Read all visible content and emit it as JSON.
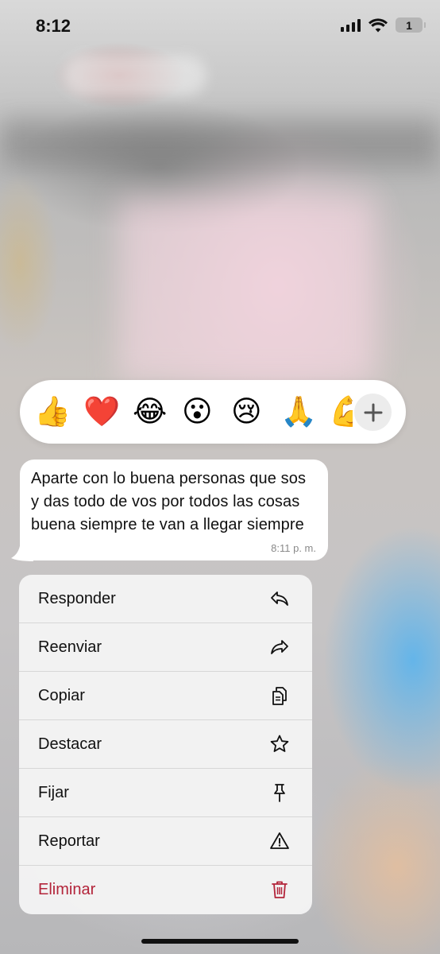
{
  "status_bar": {
    "time": "8:12",
    "battery_level": "1",
    "signal_icon": "cellular-signal-icon",
    "wifi_icon": "wifi-icon"
  },
  "reactions": {
    "emojis": [
      "👍",
      "❤️",
      "😂",
      "😮",
      "😢",
      "🙏",
      "💪"
    ],
    "more_icon": "plus-icon"
  },
  "message": {
    "text": "Aparte con lo buena personas que sos y das todo de vos por todos las cosas buena siempre te van a llegar siempre",
    "time": "8:11 p. m."
  },
  "menu": {
    "items": [
      {
        "label": "Responder",
        "icon": "reply-icon"
      },
      {
        "label": "Reenviar",
        "icon": "forward-icon"
      },
      {
        "label": "Copiar",
        "icon": "copy-icon"
      },
      {
        "label": "Destacar",
        "icon": "star-icon"
      },
      {
        "label": "Fijar",
        "icon": "pin-icon"
      },
      {
        "label": "Reportar",
        "icon": "warning-icon"
      },
      {
        "label": "Eliminar",
        "icon": "trash-icon"
      }
    ],
    "danger_color": "#b3243a"
  }
}
